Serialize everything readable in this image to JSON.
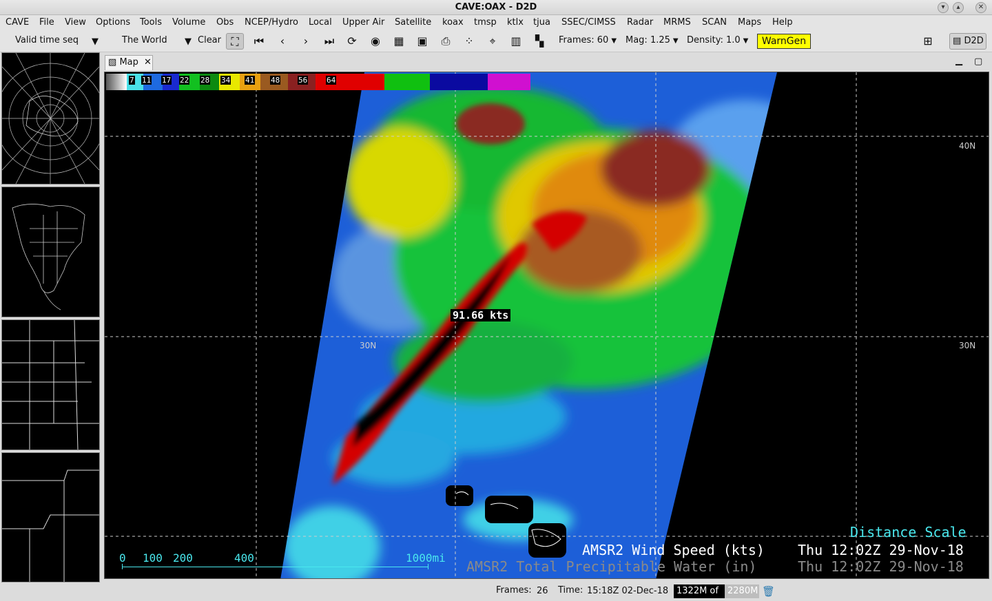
{
  "window": {
    "title": "CAVE:OAX - D2D"
  },
  "menu": [
    "CAVE",
    "File",
    "View",
    "Options",
    "Tools",
    "Volume",
    "Obs",
    "NCEP/Hydro",
    "Local",
    "Upper Air",
    "Satellite",
    "koax",
    "tmsp",
    "ktlx",
    "tjua",
    "SSEC/CIMSS",
    "Radar",
    "MRMS",
    "SCAN",
    "Maps",
    "Help"
  ],
  "toolbar": {
    "loop_mode": "Valid time seq",
    "scale": "The World",
    "clear": "Clear",
    "frames": "Frames: 60",
    "mag": "Mag: 1.25",
    "density": "Density: 1.0",
    "warngen": "WarnGen",
    "perspective": "D2D"
  },
  "tab": {
    "label": "Map"
  },
  "colorbar": {
    "labels": [
      "7",
      "11",
      "17",
      "22",
      "28",
      "34",
      "41",
      "48",
      "56",
      "64"
    ]
  },
  "map": {
    "sample_readout": "91.66 kts",
    "lat_labels": [
      "40N",
      "30N",
      "30N"
    ],
    "distance_scale": {
      "title": "Distance Scale",
      "ticks": [
        "0",
        "100",
        "200",
        "400",
        "1000mi"
      ]
    },
    "legend": [
      {
        "name": "AMSR2 Wind Speed (kts)",
        "time": "Thu 12:02Z 29-Nov-18",
        "color": "#ffffff"
      },
      {
        "name": "AMSR2 Total Precipitable Water (in)",
        "time": "Thu 12:02Z 29-Nov-18",
        "color": "#8a8a8a"
      }
    ]
  },
  "status": {
    "frames_label": "Frames:",
    "frames_value": "26",
    "time_label": "Time:",
    "time_value": "15:18Z 02-Dec-18",
    "memory_used": "1322M of",
    "memory_total": "2280M"
  }
}
